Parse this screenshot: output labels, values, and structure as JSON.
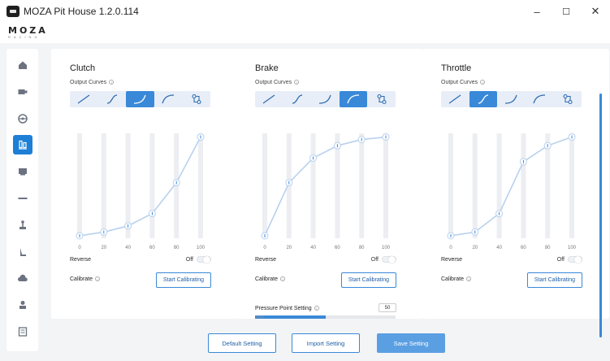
{
  "window": {
    "title": "MOZA Pit House 1.2.0.114",
    "minimize": "–",
    "maximize": "☐",
    "close": "✕"
  },
  "brand": {
    "name": "MOZA",
    "sub": "RACING"
  },
  "sidebar": {
    "items": [
      {
        "icon": "home-icon",
        "active": false
      },
      {
        "icon": "wheelbase-icon",
        "active": false
      },
      {
        "icon": "steering-wheel-icon",
        "active": false
      },
      {
        "icon": "pedals-icon",
        "active": true
      },
      {
        "icon": "dashboard-icon",
        "active": false
      },
      {
        "icon": "handbrake-icon",
        "active": false
      },
      {
        "icon": "shifter-icon",
        "active": false
      },
      {
        "icon": "hand-brake-lever-icon",
        "active": false
      },
      {
        "icon": "cloud-icon",
        "active": false
      },
      {
        "icon": "user-icon",
        "active": false
      },
      {
        "icon": "feedback-icon",
        "active": false
      }
    ]
  },
  "common": {
    "output_curves_label": "Output Curves",
    "reverse_label": "Reverse",
    "off_label": "Off",
    "calibrate_label": "Calibrate",
    "start_calibrating": "Start Calibrating",
    "x_ticks": [
      "0",
      "20",
      "40",
      "60",
      "80",
      "100"
    ],
    "info": "i"
  },
  "panels": [
    {
      "title": "Clutch",
      "active_curve": 2,
      "points": [
        2,
        5,
        10,
        20,
        45,
        82
      ]
    },
    {
      "title": "Brake",
      "active_curve": 3,
      "points": [
        2,
        45,
        65,
        75,
        80,
        82
      ]
    },
    {
      "title": "Throttle",
      "active_curve": 1,
      "points": [
        2,
        5,
        20,
        62,
        75,
        82
      ]
    }
  ],
  "pressure_point": {
    "label": "Pressure Point Setting",
    "value": "50",
    "min": "0/100",
    "fraction": 0.5
  },
  "footer": {
    "default_setting": "Default Setting",
    "import_setting": "Import Setting",
    "save_setting": "Save Setting"
  },
  "colors": {
    "accent": "#3a89d8",
    "accent_dark": "#1f5fa8",
    "curve_bar": "#e8eef8",
    "primary_button": "#5b9fe3"
  }
}
